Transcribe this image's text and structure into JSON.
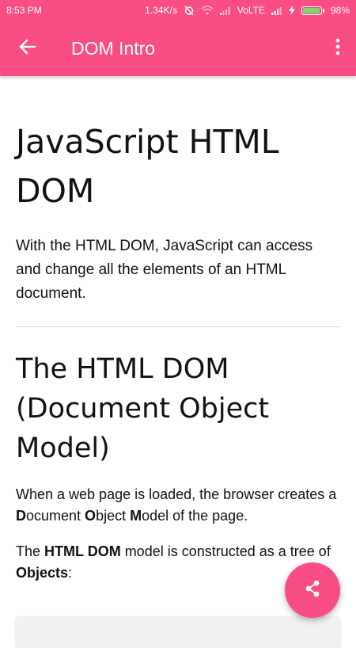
{
  "status_bar": {
    "time": "8:53 PM",
    "network_speed": "1.34K/s",
    "network_type": "VoLTE",
    "battery": "98%",
    "battery_level": 0.98,
    "icons": [
      "alarm-off-icon",
      "wifi-icon",
      "signal-icon",
      "charging-icon",
      "battery-icon"
    ]
  },
  "app_bar": {
    "title": "DOM Intro",
    "back_icon": "arrow-left-icon",
    "menu_icon": "more-vert-icon"
  },
  "colors": {
    "accent": "#f84e84",
    "battery_fill": "#7dd56f"
  },
  "article": {
    "heading": "JavaScript HTML DOM",
    "intro": "With the HTML DOM, JavaScript can access and change all the elements of an HTML document.",
    "section_heading": "The HTML DOM (Document Object Model)",
    "para1_before": "When a web page is loaded, the browser creates a ",
    "para1_D": "D",
    "para1_ocument": "ocument ",
    "para1_O": "O",
    "para1_bject": "bject ",
    "para1_M": "M",
    "para1_after": "odel of the page.",
    "para2_before": "The ",
    "para2_bold1": "HTML DOM",
    "para2_mid": " model is constructed as a tree of ",
    "para2_bold2": "Objects",
    "para2_after": ":"
  },
  "fab": {
    "icon": "share-icon"
  }
}
